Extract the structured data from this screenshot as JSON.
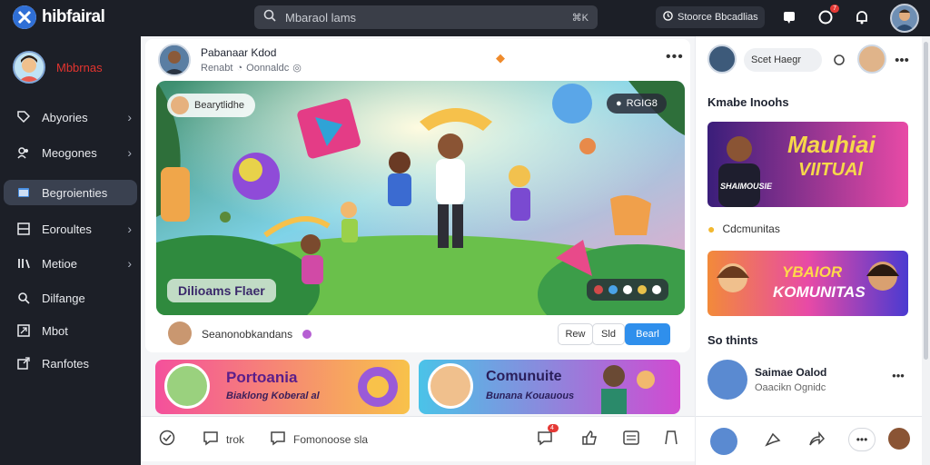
{
  "app": {
    "name": "hibfairal"
  },
  "search": {
    "placeholder": "Mbaraol lams",
    "shortcut": "⌘K"
  },
  "topbar": {
    "button_label": "Stoorce Bbcadlias",
    "notif_badge": "7"
  },
  "profile": {
    "name": "Mbbrnas"
  },
  "sidebar": {
    "items": [
      {
        "label": "Abyories",
        "chevron": true
      },
      {
        "label": "Meogones",
        "chevron": true
      },
      {
        "label": "Begroienties",
        "chevron": false,
        "active": true
      },
      {
        "label": "Eoroultes",
        "chevron": true
      },
      {
        "label": "Metioe",
        "chevron": true
      },
      {
        "label": "Dilfange",
        "chevron": false
      },
      {
        "label": "Mbot",
        "chevron": false
      },
      {
        "label": "Ranfotes",
        "chevron": false
      }
    ]
  },
  "post": {
    "author": "Pabanaar Kdod",
    "meta": "Renabt",
    "meta_secondary": "Oonnaldc",
    "image_chip": "Bearytlidhe",
    "image_pill": "RGIG8",
    "image_caption": "Dilioams Flaer",
    "footer_name": "Seanonobkandans",
    "btn_1": "Rew",
    "btn_2": "Sld",
    "btn_3": "Bearl"
  },
  "thumbs": [
    {
      "title": "Portoania",
      "subtitle": "Biaklong Koberal al"
    },
    {
      "title": "Comunuite",
      "subtitle": "Bunana Kouauous"
    }
  ],
  "action_bar": {
    "reply": "trok",
    "comment": "Fomonoose sla",
    "badge": "4"
  },
  "right": {
    "search_label": "Scet Haegr",
    "section_1": "Kmabe Inoohs",
    "promo_1": {
      "title": "Mauhiai",
      "subtitle": "VIITUAl",
      "tag": "SHAIMOUSIE"
    },
    "community_label": "Cdcmunitas",
    "promo_2": {
      "title": "YBAIOR",
      "subtitle": "KOMUNITAS"
    },
    "section_2": "So thints",
    "feed": {
      "name": "Saimae Oalod",
      "meta": "Oaacikn Ognidc"
    }
  },
  "colors": {
    "accent": "#2f8fec",
    "dark": "#1c1f27",
    "brand_red": "#e3342f"
  }
}
